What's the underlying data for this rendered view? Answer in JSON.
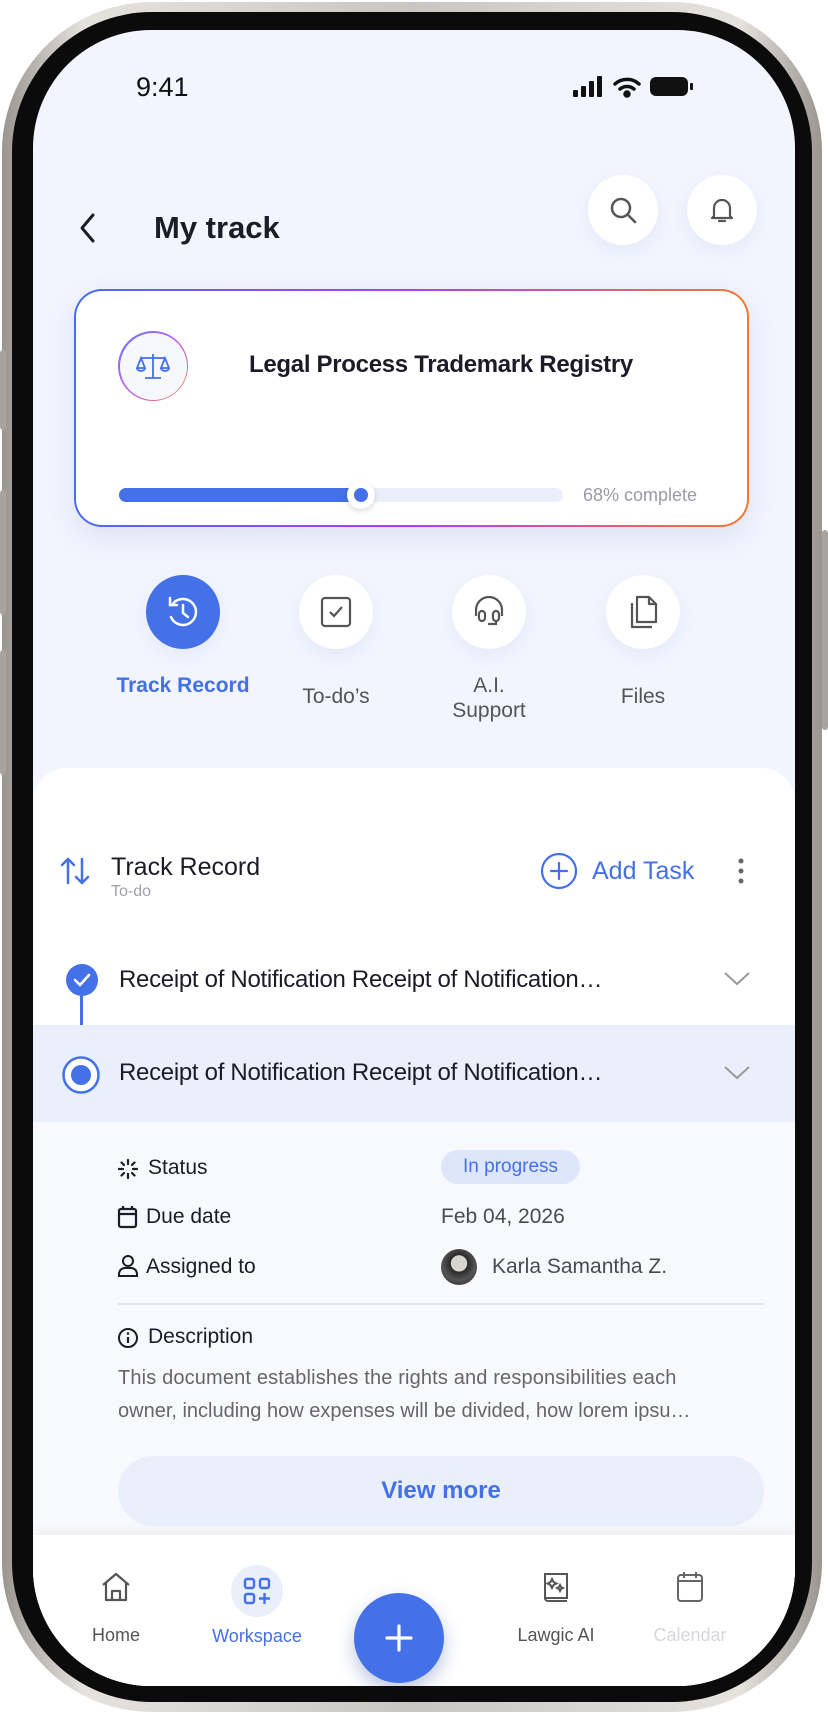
{
  "status_bar": {
    "time": "9:41"
  },
  "header": {
    "title": "My track",
    "back_icon": "chevron-left-icon",
    "search_icon": "search-icon",
    "bell_icon": "bell-icon"
  },
  "case_card": {
    "title": "Legal Process Trademark Registry",
    "icon": "scales-icon",
    "progress_percent": 68,
    "progress_label": "68% complete",
    "colors": {
      "accent": "#4470e8",
      "gradient": [
        "#4a6cf0",
        "#b43cf0",
        "#f07a30"
      ]
    }
  },
  "tabs": [
    {
      "label": "Track Record",
      "icon": "history-icon",
      "active": true
    },
    {
      "label": "To-do’s",
      "icon": "checkbox-icon",
      "active": false
    },
    {
      "label": "A.I. Support",
      "icon": "headset-icon",
      "active": false
    },
    {
      "label": "Files",
      "icon": "files-icon",
      "active": false
    }
  ],
  "section": {
    "title": "Track Record",
    "subtitle": "To-do",
    "add_label": "Add Task"
  },
  "tasks": [
    {
      "title": "Receipt of Notification Receipt of Notification…",
      "state": "done"
    },
    {
      "title": "Receipt of Notification Receipt of Notification…",
      "state": "current",
      "expanded": true
    }
  ],
  "details": {
    "status_label": "Status",
    "status_value": "In progress",
    "due_label": "Due date",
    "due_value": "Feb 04, 2026",
    "assigned_label": "Assigned to",
    "assigned_value": "Karla Samantha Z.",
    "description_label": "Description",
    "description_line1": "This document establishes the rights and responsibilities each",
    "description_line2": "owner, including how expenses will be divided, how lorem ipsu…",
    "view_more": "View more"
  },
  "bottom_nav": [
    {
      "label": "Home",
      "icon": "home-icon"
    },
    {
      "label": "Workspace",
      "icon": "workspace-icon",
      "active": true
    },
    {
      "label": "Lawgic AI",
      "icon": "ai-book-icon"
    },
    {
      "label": "Calendar",
      "icon": "calendar-icon",
      "disabled": true
    }
  ]
}
